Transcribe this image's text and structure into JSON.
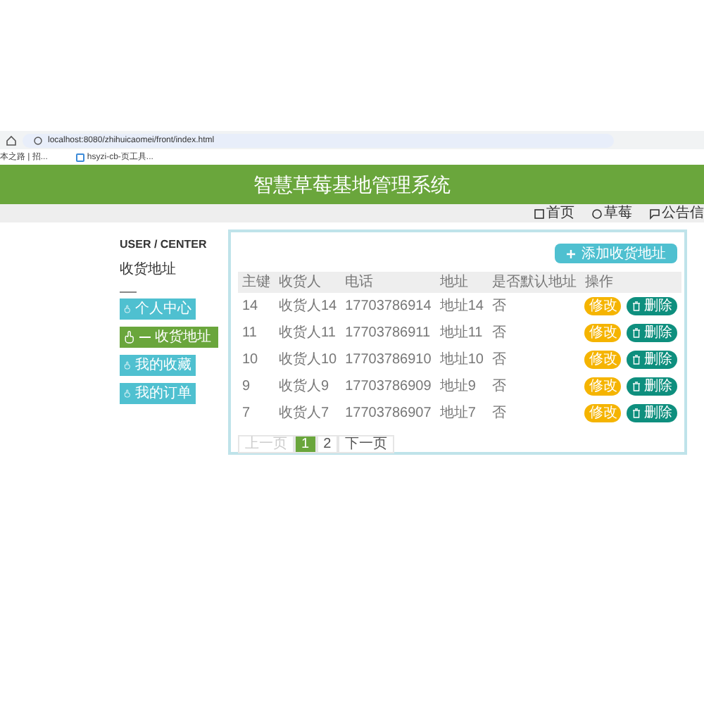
{
  "browser": {
    "address": "localhost:8080/zhihuicaomei/front/index.html",
    "bookmarks": [
      "本之路 | 招...",
      "hsyzi-cb-页工具..."
    ]
  },
  "header": {
    "title": "智慧草莓基地管理系统"
  },
  "nav": [
    {
      "label": "首页"
    },
    {
      "label": "草莓"
    },
    {
      "label": "公告信"
    }
  ],
  "sidebar": {
    "heading": "USER / CENTER",
    "subtitle": "收货地址",
    "items": [
      {
        "label": "个人中心",
        "selected": false
      },
      {
        "label": "收货地址",
        "selected": true
      },
      {
        "label": "我的收藏",
        "selected": false
      },
      {
        "label": "我的订单",
        "selected": false
      }
    ]
  },
  "add_button": "添加收货地址",
  "table": {
    "columns": [
      "主键",
      "收货人",
      "电话",
      "地址",
      "是否默认地址",
      "操作"
    ],
    "rows": [
      {
        "cells": [
          "14",
          "收货人14",
          "17703786914",
          "地址14",
          "否"
        ],
        "actions": [
          "修改",
          "删除"
        ]
      },
      {
        "cells": [
          "11",
          "收货人11",
          "17703786911",
          "地址11",
          "否"
        ],
        "actions": [
          "修改",
          "删除"
        ]
      },
      {
        "cells": [
          "10",
          "收货人10",
          "17703786910",
          "地址10",
          "否"
        ],
        "actions": [
          "修改",
          "删除"
        ]
      },
      {
        "cells": [
          "9",
          "收货人9",
          "17703786909",
          "地址9",
          "否"
        ],
        "actions": [
          "修改",
          "删除"
        ]
      },
      {
        "cells": [
          "7",
          "收货人7",
          "17703786907",
          "地址7",
          "否"
        ],
        "actions": [
          "修改",
          "删除"
        ]
      }
    ]
  },
  "pagination": [
    {
      "label": "上一页",
      "kind": "prev",
      "selected": false
    },
    {
      "label": "1",
      "kind": "page",
      "selected": true
    },
    {
      "label": "2",
      "kind": "page",
      "selected": false
    },
    {
      "label": "下一页",
      "kind": "next",
      "selected": false
    }
  ]
}
